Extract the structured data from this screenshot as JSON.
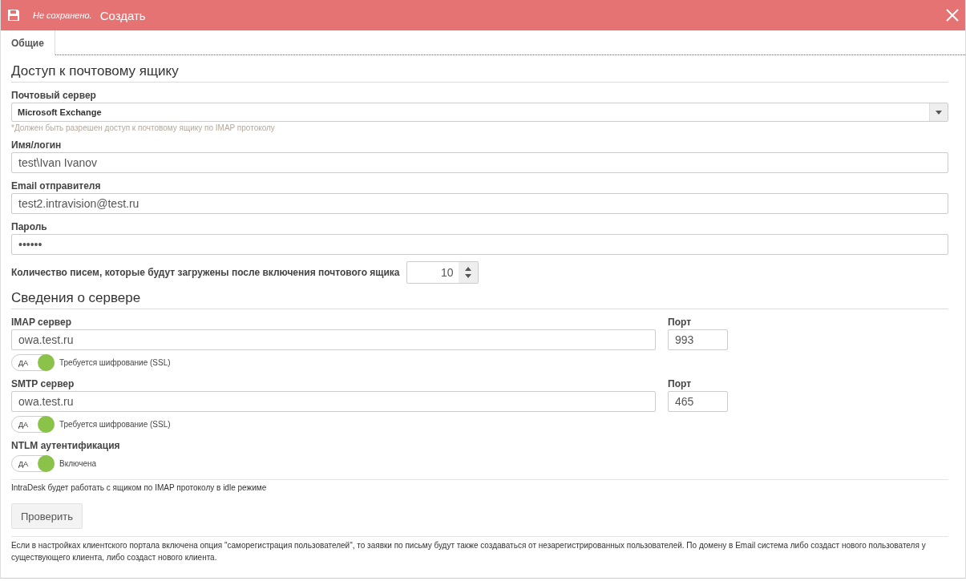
{
  "window": {
    "status": "Не сохранено.",
    "title": "Создать"
  },
  "tabs": [
    {
      "label": "Общие",
      "selected": true
    }
  ],
  "mailbox": {
    "heading": "Доступ к почтовому ящику",
    "server": {
      "label": "Почтовый сервер",
      "value": "Microsoft Exchange",
      "hint": "*Должен быть разрешен доступ к почтовому ящику по IMAP протоколу"
    },
    "fields": [
      {
        "label": "Имя/логин",
        "value": "test\\Ivan Ivanov"
      },
      {
        "label": "Email отправителя",
        "value": "test2.intravision@test.ru"
      },
      {
        "label": "Пароль",
        "value": "••••••"
      }
    ],
    "count": {
      "label": "Количество писем, которые будут загружены после включения почтового ящика",
      "value": "10"
    }
  },
  "server_info": {
    "heading": "Сведения о сервере",
    "servers": [
      {
        "label": "IMAP сервер",
        "value": "owa.test.ru",
        "port_label": "Порт",
        "port": "993",
        "toggle": {
          "text": "ДА",
          "on": true,
          "caption": "Требуется шифрование (SSL)"
        }
      },
      {
        "label": "SMTP сервер",
        "value": "owa.test.ru",
        "port_label": "Порт",
        "port": "465",
        "toggle": {
          "text": "ДА",
          "on": true,
          "caption": "Требуется шифрование (SSL)"
        }
      }
    ],
    "ntlm": {
      "label": "NTLM аутентификация",
      "toggle": {
        "text": "ДА",
        "on": true,
        "caption": "Включена"
      }
    }
  },
  "idle_note": "IntraDesk будет работать с ящиком по IMAP протоколу в idle режиме",
  "check_button": "Проверить",
  "footer_note": "Если в настройках клиентского портала включена опция \"саморегистрация пользователей\", то заявки по письму будут также создаваться от незарегистрированных пользователей. По домену в Email система либо создаст нового пользователя у существующего клиента, либо создаст нового клиента."
}
